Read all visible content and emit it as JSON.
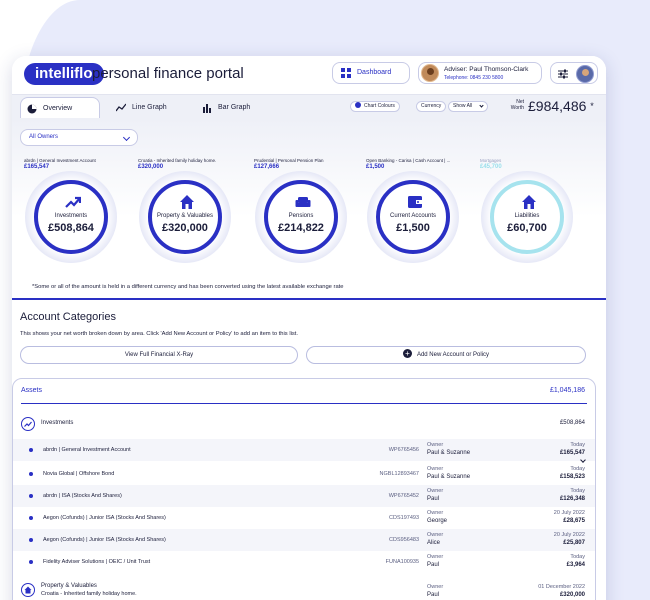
{
  "app": {
    "logo": "intelliflo",
    "title": "personal finance portal"
  },
  "header": {
    "dashboard_label": "Dashboard",
    "adviser_line": "Adviser: Paul Thomson-Clark",
    "telephone_line": "Telephone: 0845 230 5800"
  },
  "tabs": [
    {
      "label": "Overview",
      "icon": "pie-chart-icon",
      "active": true
    },
    {
      "label": "Line Graph",
      "icon": "line-graph-icon",
      "active": false
    },
    {
      "label": "Bar Graph",
      "icon": "bar-graph-icon",
      "active": false
    }
  ],
  "toolbar": {
    "chart_colours": "Chart Colours",
    "currency": "Currency",
    "show_all": "Show All",
    "net_worth_label": "Net Worth",
    "net_worth_value": "£984,486",
    "net_worth_star": "*"
  },
  "filter": {
    "owners": "All Owners"
  },
  "tiles": [
    {
      "source": "abrdn | General Investment Account",
      "amount": "£165,547",
      "label": "Investments",
      "value": "£508,864",
      "icon": "trend-up-icon",
      "light": false
    },
    {
      "source": "Croatia - Inherited family holiday home.",
      "amount": "£320,000",
      "label": "Property & Valuables",
      "value": "£320,000",
      "icon": "house-icon",
      "light": false
    },
    {
      "source": "Prudential | Personal Pension Plan",
      "amount": "£127,666",
      "label": "Pensions",
      "value": "£214,822",
      "icon": "sofa-icon",
      "light": false
    },
    {
      "source": "Open Banking - Carisa | Cash Account | ...",
      "amount": "£1,500",
      "label": "Current Accounts",
      "value": "£1,500",
      "icon": "wallet-icon",
      "light": false
    },
    {
      "source": "Mortgages",
      "amount": "£45,700",
      "label": "Liabilities",
      "value": "£60,700",
      "icon": "house-icon",
      "light": true
    }
  ],
  "note": "*Some or all of the amount is held in a different currency and has been converted using the latest available exchange rate",
  "account_categories": {
    "title": "Account Categories",
    "description": "This shows your net worth broken down by area. Click 'Add New Account or Policy' to add an item to this list.",
    "xray_button": "View Full Financial X-Ray",
    "add_button": "Add New Account or Policy"
  },
  "assets": {
    "title": "Assets",
    "total": "£1,045,186",
    "groups": [
      {
        "name": "Investments",
        "value": "£508,864",
        "rows": [
          {
            "name": "abrdn | General Investment Account",
            "ref": "WP6765456",
            "owner_label": "Owner",
            "owner": "Paul & Suzanne",
            "date": "Today",
            "amount": "£165,547"
          },
          {
            "name": "Novia Global | Offshore Bond",
            "ref": "NGBL12893467",
            "owner_label": "Owner",
            "owner": "Paul & Suzanne",
            "date": "Today",
            "amount": "£158,523"
          },
          {
            "name": "abrdn | ISA (Stocks And Shares)",
            "ref": "WP6765452",
            "owner_label": "Owner",
            "owner": "Paul",
            "date": "Today",
            "amount": "£126,348"
          },
          {
            "name": "Aegon (Cofunds) | Junior ISA (Stocks And Shares)",
            "ref": "CDS197493",
            "owner_label": "Owner",
            "owner": "George",
            "date": "20 July 2022",
            "amount": "£28,675"
          },
          {
            "name": "Aegon (Cofunds) | Junior ISA (Stocks And Shares)",
            "ref": "CDS956483",
            "owner_label": "Owner",
            "owner": "Alice",
            "date": "20 July 2022",
            "amount": "£25,807"
          },
          {
            "name": "Fidelity Adviser Solutions | OEIC / Unit Trust",
            "ref": "FUNA100935",
            "owner_label": "Owner",
            "owner": "Paul",
            "date": "Today",
            "amount": "£3,964"
          }
        ]
      }
    ],
    "property": {
      "name": "Property & Valuables",
      "detail": "Croatia - Inherited family holiday home.",
      "owner_label": "Owner",
      "owner": "Paul",
      "date": "01 December 2022",
      "amount": "£320,000"
    }
  },
  "colors": {
    "brand": "#2a30c4",
    "text": "#1b1d3a",
    "liability_ring": "#a6e3ee"
  }
}
